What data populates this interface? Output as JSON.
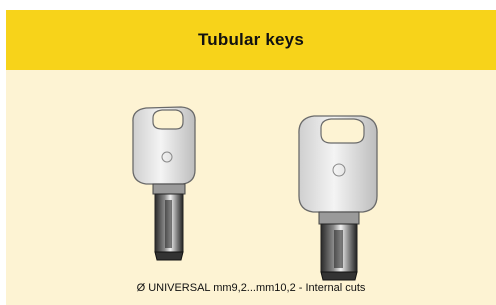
{
  "header": {
    "title": "Tubular keys"
  },
  "illustration": {
    "keys": [
      {
        "name": "small tubular key"
      },
      {
        "name": "large tubular key"
      }
    ]
  },
  "caption": {
    "text": "Ø UNIVERSAL mm9,2...mm10,2 - Internal cuts"
  }
}
